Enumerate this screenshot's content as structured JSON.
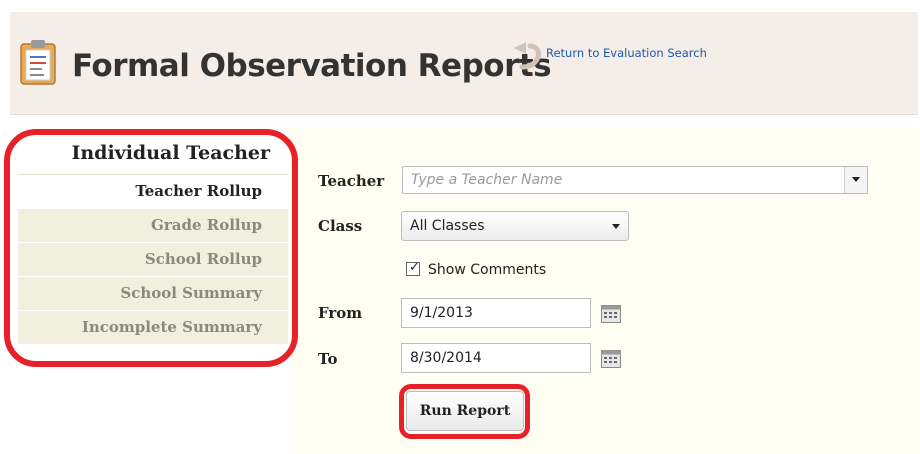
{
  "header": {
    "title": "Formal Observation Reports",
    "return_link": "Return to Evaluation Search"
  },
  "sidebar": {
    "title": "Individual Teacher",
    "items": [
      {
        "label": "Teacher Rollup",
        "active": true
      },
      {
        "label": "Grade Rollup"
      },
      {
        "label": "School Rollup"
      },
      {
        "label": "School Summary"
      },
      {
        "label": "Incomplete Summary"
      }
    ]
  },
  "form": {
    "teacher_label": "Teacher",
    "teacher_placeholder": "Type a Teacher Name",
    "class_label": "Class",
    "class_value": "All Classes",
    "show_comments_label": "Show Comments",
    "show_comments_checked": true,
    "from_label": "From",
    "from_value": "9/1/2013",
    "to_label": "To",
    "to_value": "8/30/2014",
    "run_button": "Run Report"
  },
  "colors": {
    "highlight": "#e8202a",
    "header_bg": "#f5eee8",
    "form_bg": "#fffef2",
    "link": "#1f5aa6"
  }
}
